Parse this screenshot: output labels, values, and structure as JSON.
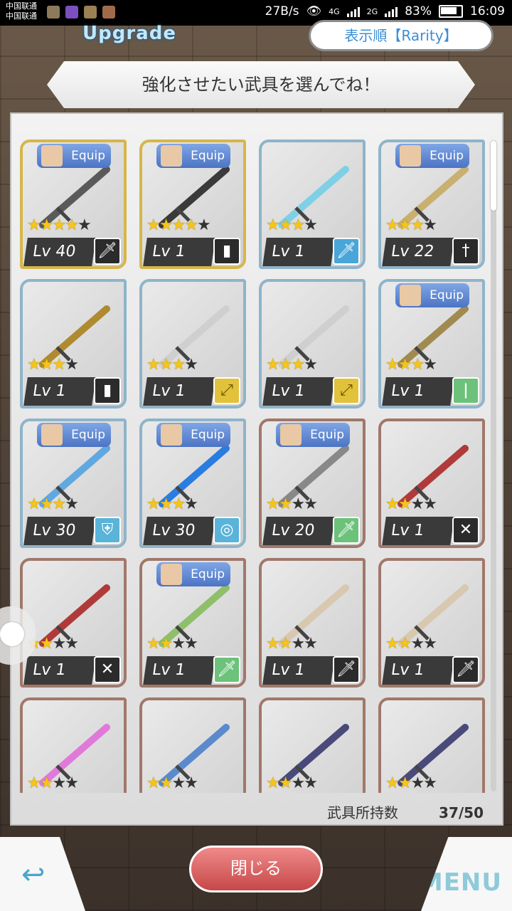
{
  "status_bar": {
    "carrier_1": "中国联通",
    "carrier_2": "中国联通",
    "net_speed": "27B/s",
    "net_4g_1": "4G",
    "net_4g_2": "4G",
    "net_2g": "2G",
    "battery": "83%",
    "time": "16:09"
  },
  "header": {
    "title": "Upgrade",
    "sort_button": "表示順【Rarity】",
    "instruction": "強化させたい武具を選んでね！"
  },
  "equip_label": "Equip",
  "items": [
    {
      "equip": true,
      "stars": 4,
      "level": "Lv 40",
      "type_icon": "one-hand-sword-icon",
      "type_glyph": "🗡",
      "type_color": "black",
      "frame": "gold"
    },
    {
      "equip": true,
      "stars": 4,
      "level": "Lv 1",
      "type_icon": "bullet-icon",
      "type_glyph": "▮",
      "type_color": "black",
      "frame": "gold"
    },
    {
      "equip": false,
      "stars": 3,
      "level": "Lv 1",
      "type_icon": "one-hand-sword-icon",
      "type_glyph": "🗡",
      "type_color": "blue",
      "frame": "silver"
    },
    {
      "equip": true,
      "stars": 3,
      "level": "Lv 22",
      "type_icon": "rapier-icon",
      "type_glyph": "†",
      "type_color": "black",
      "frame": "silver"
    },
    {
      "equip": false,
      "stars": 3,
      "level": "Lv 1",
      "type_icon": "bullet-icon",
      "type_glyph": "▮",
      "type_color": "black",
      "frame": "silver"
    },
    {
      "equip": false,
      "stars": 3,
      "level": "Lv 1",
      "type_icon": "bow-icon",
      "type_glyph": "⤢",
      "type_color": "yellow",
      "frame": "silver"
    },
    {
      "equip": false,
      "stars": 3,
      "level": "Lv 1",
      "type_icon": "bow-icon",
      "type_glyph": "⤢",
      "type_color": "yellow",
      "frame": "silver"
    },
    {
      "equip": true,
      "stars": 3,
      "level": "Lv 1",
      "type_icon": "staff-icon",
      "type_glyph": "ǀ",
      "type_color": "green",
      "frame": "silver"
    },
    {
      "equip": true,
      "stars": 3,
      "level": "Lv 30",
      "type_icon": "armor-icon",
      "type_glyph": "⛨",
      "type_color": "cyan",
      "frame": "silver"
    },
    {
      "equip": true,
      "stars": 3,
      "level": "Lv 30",
      "type_icon": "accessory-icon",
      "type_glyph": "◎",
      "type_color": "cyan",
      "frame": "silver"
    },
    {
      "equip": true,
      "stars": 2,
      "level": "Lv 20",
      "type_icon": "one-hand-sword-icon",
      "type_glyph": "🗡",
      "type_color": "green",
      "frame": "bronze"
    },
    {
      "equip": false,
      "stars": 2,
      "level": "Lv 1",
      "type_icon": "dual-blades-icon",
      "type_glyph": "✕",
      "type_color": "black",
      "frame": "bronze"
    },
    {
      "equip": false,
      "stars": 2,
      "level": "Lv 1",
      "type_icon": "dual-blades-icon",
      "type_glyph": "✕",
      "type_color": "black",
      "frame": "bronze"
    },
    {
      "equip": true,
      "stars": 2,
      "level": "Lv 1",
      "type_icon": "dagger-icon",
      "type_glyph": "🗡",
      "type_color": "green",
      "frame": "bronze"
    },
    {
      "equip": false,
      "stars": 2,
      "level": "Lv 1",
      "type_icon": "dagger-icon",
      "type_glyph": "🗡",
      "type_color": "black",
      "frame": "bronze"
    },
    {
      "equip": false,
      "stars": 2,
      "level": "Lv 1",
      "type_icon": "dagger-icon",
      "type_glyph": "🗡",
      "type_color": "black",
      "frame": "bronze"
    },
    {
      "equip": false,
      "stars": 2,
      "level": "",
      "type_icon": "",
      "type_glyph": "",
      "type_color": "",
      "frame": "bronze"
    },
    {
      "equip": false,
      "stars": 2,
      "level": "",
      "type_icon": "",
      "type_glyph": "",
      "type_color": "",
      "frame": "bronze"
    },
    {
      "equip": false,
      "stars": 2,
      "level": "",
      "type_icon": "",
      "type_glyph": "",
      "type_color": "",
      "frame": "bronze"
    },
    {
      "equip": false,
      "stars": 2,
      "level": "",
      "type_icon": "",
      "type_glyph": "",
      "type_color": "",
      "frame": "bronze"
    }
  ],
  "footer": {
    "count_label": "武具所持数",
    "count_value": "37/50",
    "close_button": "閉じる",
    "menu_button": "MENU"
  }
}
